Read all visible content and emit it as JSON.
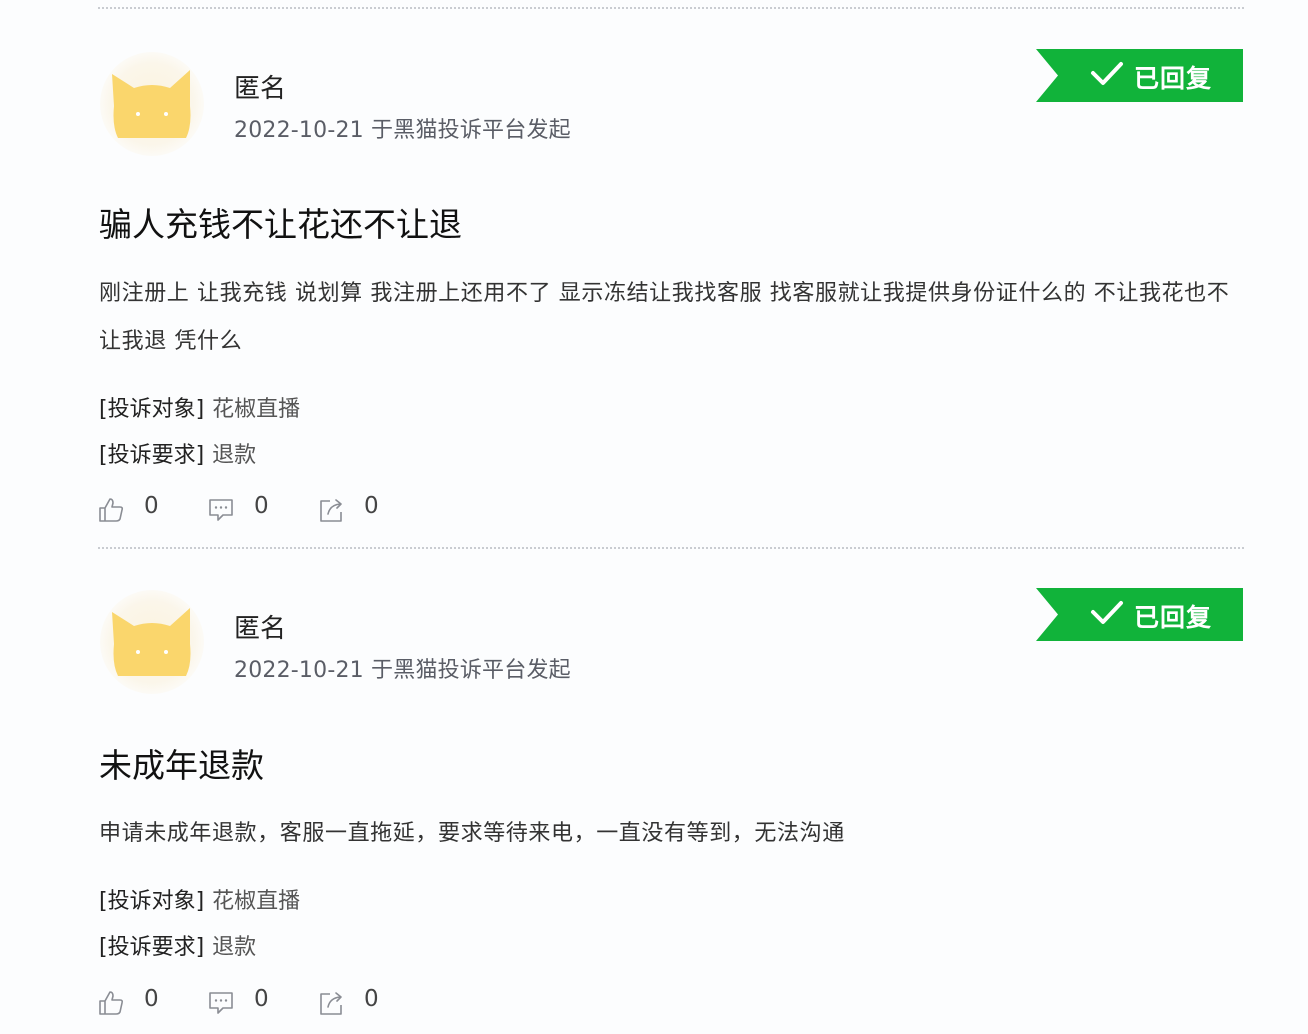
{
  "badge_color": "#11b33a",
  "avatar_color": "#fad66c",
  "posts": [
    {
      "author": "匿名",
      "meta": "2022-10-21 于黑猫投诉平台发起",
      "status": "已回复",
      "title": "骗人充钱不让花还不让退",
      "body": "刚注册上 让我充钱 说划算 我注册上还用不了 显示冻结让我找客服 找客服就让我提供身份证什么的 不让我花也不让我退 凭什么",
      "target_key": "[投诉对象]",
      "target_value": "花椒直播",
      "demand_key": "[投诉要求]",
      "demand_value": "退款",
      "likes": "0",
      "comments": "0",
      "shares": "0"
    },
    {
      "author": "匿名",
      "meta": "2022-10-21 于黑猫投诉平台发起",
      "status": "已回复",
      "title": "未成年退款",
      "body": "申请未成年退款，客服一直拖延，要求等待来电，一直没有等到，无法沟通",
      "target_key": "[投诉对象]",
      "target_value": "花椒直播",
      "demand_key": "[投诉要求]",
      "demand_value": "退款",
      "likes": "0",
      "comments": "0",
      "shares": "0"
    }
  ],
  "icons": {
    "avatar": "cat-avatar-icon",
    "check": "check-icon",
    "like": "thumbs-up-icon",
    "comment": "comment-icon",
    "share": "share-icon"
  }
}
